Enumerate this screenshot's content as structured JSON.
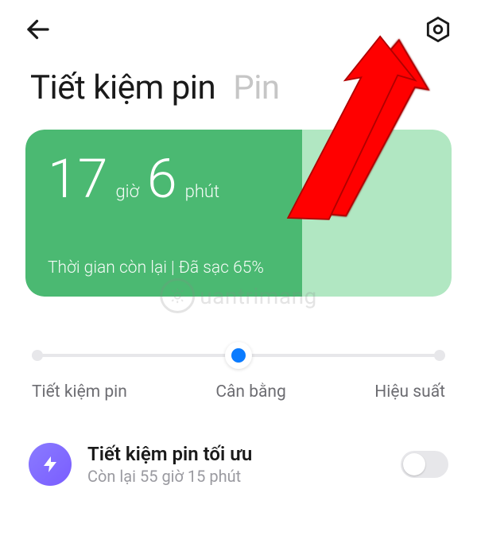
{
  "tabs": {
    "active": "Tiết kiệm pin",
    "inactive": "Pin"
  },
  "card": {
    "hours": "17",
    "hours_unit": "giờ",
    "minutes": "6",
    "minutes_unit": "phút",
    "status": "Thời gian còn lại | Đã sạc 65%",
    "fill_percent": 65
  },
  "slider": {
    "labels": [
      "Tiết kiệm pin",
      "Cân bằng",
      "Hiệu suất"
    ],
    "position": 1
  },
  "option": {
    "title": "Tiết kiệm pin tối ưu",
    "sub": "Còn lại 55 giờ 15 phút",
    "toggle_on": false
  },
  "watermark": "uantrimang"
}
